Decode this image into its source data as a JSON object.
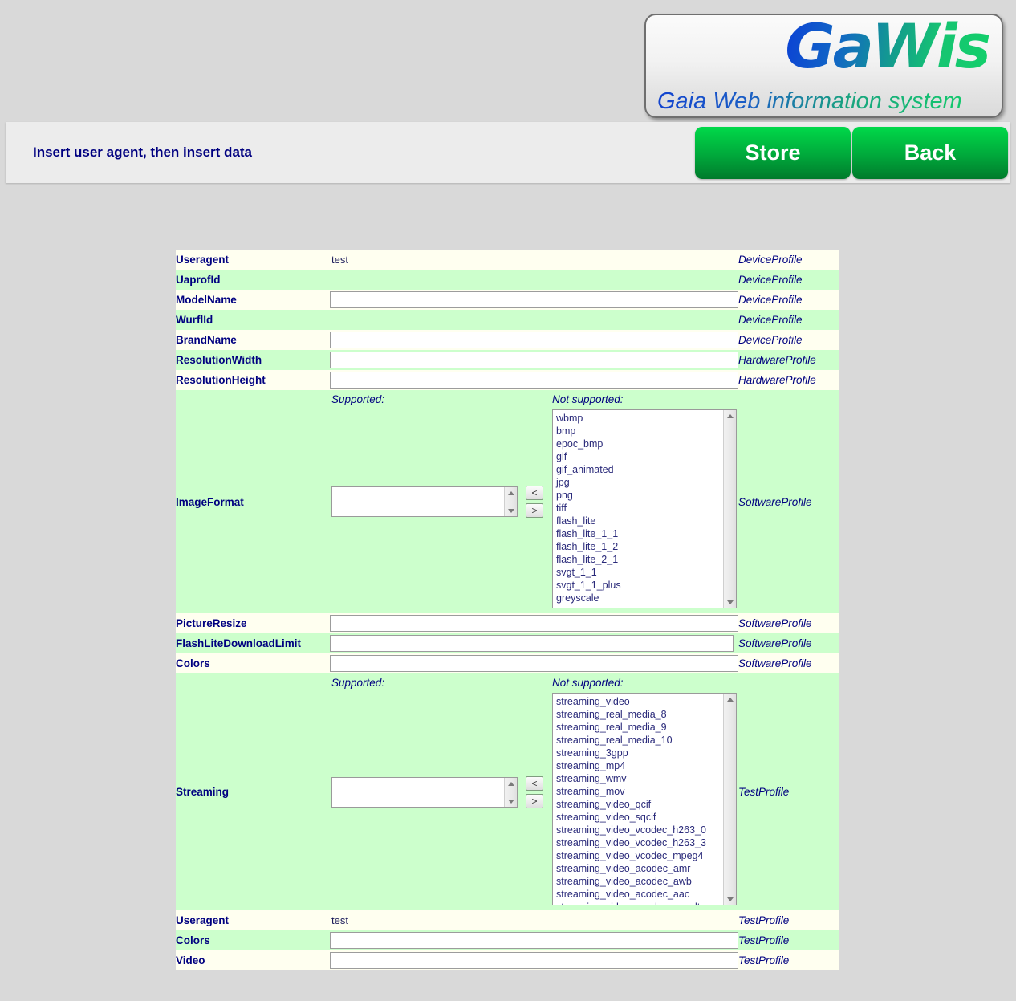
{
  "logo": {
    "wordmark": "GaWis",
    "subtitle": "Gaia Web information system"
  },
  "header": {
    "title": "Insert user agent, then insert data",
    "store_label": "Store",
    "back_label": "Back"
  },
  "listlabels": {
    "supported": "Supported:",
    "not_supported": "Not supported:",
    "move_left": "<",
    "move_right": ">"
  },
  "rows": [
    {
      "label": "Useragent",
      "type": "text",
      "value": "test",
      "profile": "DeviceProfile"
    },
    {
      "label": "UaprofId",
      "type": "empty",
      "value": "",
      "profile": "DeviceProfile"
    },
    {
      "label": "ModelName",
      "type": "input",
      "value": "",
      "profile": "DeviceProfile"
    },
    {
      "label": "WurflId",
      "type": "empty",
      "value": "",
      "profile": "DeviceProfile"
    },
    {
      "label": "BrandName",
      "type": "input",
      "value": "",
      "profile": "DeviceProfile"
    },
    {
      "label": "ResolutionWidth",
      "type": "input",
      "value": "",
      "profile": "HardwareProfile"
    },
    {
      "label": "ResolutionHeight",
      "type": "input",
      "value": "",
      "profile": "HardwareProfile"
    },
    {
      "label": "ImageFormat",
      "type": "dual",
      "value": "",
      "profile": "SoftwareProfile"
    },
    {
      "label": "PictureResize",
      "type": "input",
      "value": "",
      "profile": "SoftwareProfile"
    },
    {
      "label": "FlashLiteDownloadLimit",
      "type": "input",
      "value": "",
      "profile": "SoftwareProfile"
    },
    {
      "label": "Colors",
      "type": "input",
      "value": "",
      "profile": "SoftwareProfile"
    },
    {
      "label": "Streaming",
      "type": "dual",
      "value": "",
      "profile": "TestProfile"
    },
    {
      "label": "Useragent",
      "type": "text",
      "value": "test",
      "profile": "TestProfile"
    },
    {
      "label": "Colors",
      "type": "input",
      "value": "",
      "profile": "TestProfile"
    },
    {
      "label": "Video",
      "type": "input",
      "value": "",
      "profile": "TestProfile"
    }
  ],
  "imageformat": {
    "supported_options": [],
    "not_supported_options": [
      "wbmp",
      "bmp",
      "epoc_bmp",
      "gif",
      "gif_animated",
      "jpg",
      "png",
      "tiff",
      "flash_lite",
      "flash_lite_1_1",
      "flash_lite_1_2",
      "flash_lite_2_1",
      "svgt_1_1",
      "svgt_1_1_plus",
      "greyscale"
    ]
  },
  "streaming": {
    "supported_options": [],
    "not_supported_options": [
      "streaming_video",
      "streaming_real_media_8",
      "streaming_real_media_9",
      "streaming_real_media_10",
      "streaming_3gpp",
      "streaming_mp4",
      "streaming_wmv",
      "streaming_mov",
      "streaming_video_qcif",
      "streaming_video_sqcif",
      "streaming_video_vcodec_h263_0",
      "streaming_video_vcodec_h263_3",
      "streaming_video_vcodec_mpeg4",
      "streaming_video_acodec_amr",
      "streaming_video_acodec_awb",
      "streaming_video_acodec_aac",
      "streaming_video_acodec_aac_ltp"
    ]
  },
  "colors": {
    "page_background": "#d9d9d9",
    "header_background": "#ececec",
    "row_odd": "#fffff0",
    "row_even": "#ccffcc",
    "label_text": "#000080",
    "button_green": "#00a83b"
  }
}
